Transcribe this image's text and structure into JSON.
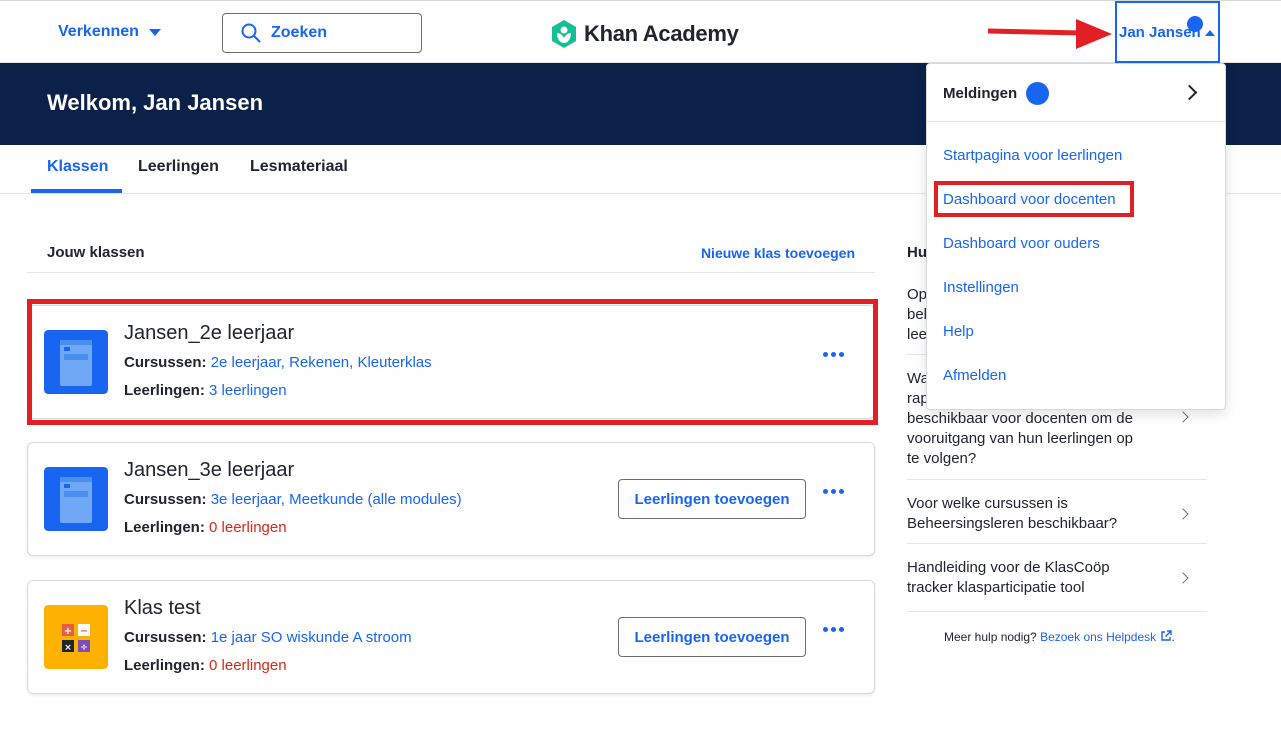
{
  "header": {
    "explore_label": "Verkennen",
    "search_placeholder": "Zoeken",
    "logo_text": "Khan Academy",
    "user_name": "Jan Jansen"
  },
  "banner": {
    "welcome": "Welkom, Jan Jansen"
  },
  "tabs": [
    {
      "label": "Klassen",
      "active": true
    },
    {
      "label": "Leerlingen",
      "active": false
    },
    {
      "label": "Lesmateriaal",
      "active": false
    }
  ],
  "classes_section": {
    "title": "Jouw klassen",
    "add_class_label": "Nieuwe klas toevoegen",
    "courses_label": "Cursussen:",
    "students_label": "Leerlingen:",
    "add_students_label": "Leerlingen toevoegen",
    "classes": [
      {
        "name": "Jansen_2e leerjaar",
        "courses": "2e leerjaar, Rekenen, Kleuterklas",
        "students": "3 leerlingen",
        "icon": "book-icon"
      },
      {
        "name": "Jansen_3e leerjaar",
        "courses": "3e leerjaar, Meetkunde (alle modules)",
        "students": "0 leerlingen",
        "icon": "book-icon"
      },
      {
        "name": "Klas test",
        "courses": "1e jaar SO wiskunde A stroom",
        "students": "0 leerlingen",
        "icon": "math-operations-icon"
      }
    ]
  },
  "help": {
    "title": "Hu",
    "items": [
      {
        "text": "Op\nbel\nlee"
      },
      {
        "text": "Wa\nrap\nbeschikbaar voor docenten om de\nvooruitgang van hun leerlingen op\nte volgen?"
      },
      {
        "text": "Voor welke cursussen is\nBeheersingsleren beschikbaar?"
      },
      {
        "text": "Handleiding voor de KlasCoöp\ntracker klasparticipatie tool"
      }
    ],
    "footer_text": "Meer hulp nodig?",
    "footer_link": "Bezoek ons Helpdesk"
  },
  "dropdown": {
    "notifications_label": "Meldingen",
    "items": [
      "Startpagina voor leerlingen",
      "Dashboard voor docenten",
      "Dashboard voor ouders",
      "Instellingen",
      "Help",
      "Afmelden"
    ]
  },
  "colors": {
    "accent": "#1865f2",
    "banner": "#0b2149",
    "annotation": "#e31f26",
    "warning": "#d92916"
  }
}
